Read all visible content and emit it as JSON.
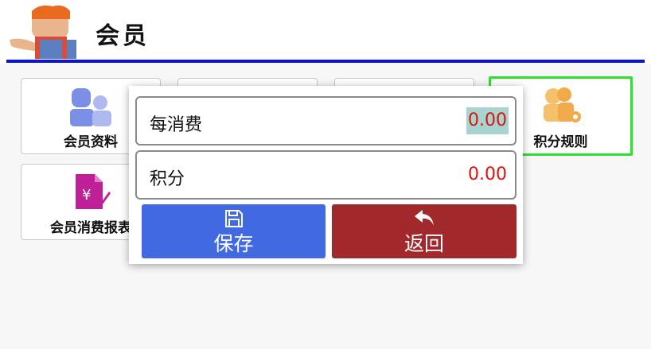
{
  "header": {
    "title": "会员"
  },
  "tiles": [
    {
      "label": "会员资料"
    },
    {
      "label": ""
    },
    {
      "label": ""
    },
    {
      "label": "积分规则"
    },
    {
      "label": "会员消费报表"
    }
  ],
  "dialog": {
    "fields": [
      {
        "label": "每消费",
        "value": "0.00"
      },
      {
        "label": "积分",
        "value": "0.00"
      }
    ],
    "save_label": "保存",
    "back_label": "返回"
  },
  "colors": {
    "accent_bar": "#0a12e0",
    "save": "#4169e1",
    "back": "#a2292b",
    "selected_border": "#2ee02e",
    "value_red": "#e01010"
  }
}
